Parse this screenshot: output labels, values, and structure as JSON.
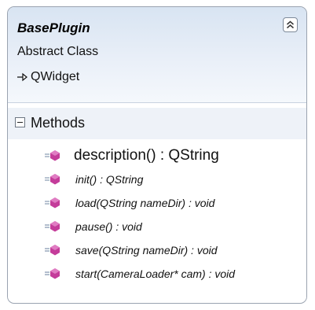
{
  "class": {
    "name": "BasePlugin",
    "stereotype": "Abstract Class",
    "base_type": "QWidget",
    "collapse_icon": "double-chevron-up-icon"
  },
  "methods_section": {
    "label": "Methods",
    "toggle_icon": "collapse-minus-icon",
    "items": [
      {
        "signature": "description() : QString",
        "abstract": false
      },
      {
        "signature": "init() : QString",
        "abstract": true
      },
      {
        "signature": "load(QString nameDir) : void",
        "abstract": true
      },
      {
        "signature": "pause() : void",
        "abstract": true
      },
      {
        "signature": "save(QString nameDir) : void",
        "abstract": true
      },
      {
        "signature": "start(CameraLoader* cam) : void",
        "abstract": true
      }
    ]
  },
  "colors": {
    "method_icon": "#c43c9a",
    "border": "#9aa3b0",
    "header_gradient_top": "#d8e4f2"
  }
}
